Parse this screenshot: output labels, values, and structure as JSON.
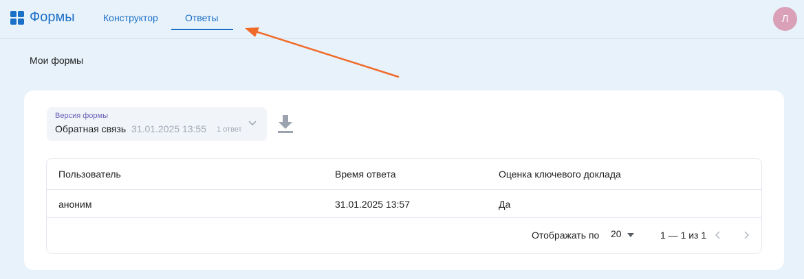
{
  "header": {
    "app_title": "Формы",
    "brand_color": "#1a6fc6",
    "tabs": [
      {
        "label": "Конструктор",
        "active": false
      },
      {
        "label": "Ответы",
        "active": true
      }
    ],
    "avatar_initial": "Л",
    "annotation_arrow_color": "#f06a2a"
  },
  "page": {
    "title": "Мои формы"
  },
  "version_select": {
    "label": "Версия формы",
    "name": "Обратная связь",
    "date": "31.01.2025 13:55",
    "count": "1 ответ"
  },
  "download_icon": "download-icon",
  "table": {
    "columns": [
      "Пользователь",
      "Время ответа",
      "Оценка ключевого доклада"
    ],
    "rows": [
      [
        "аноним",
        "31.01.2025 13:57",
        "Да"
      ]
    ]
  },
  "pagination": {
    "per_page_label": "Отображать по",
    "per_page_value": "20",
    "range": "1 — 1 из 1"
  }
}
